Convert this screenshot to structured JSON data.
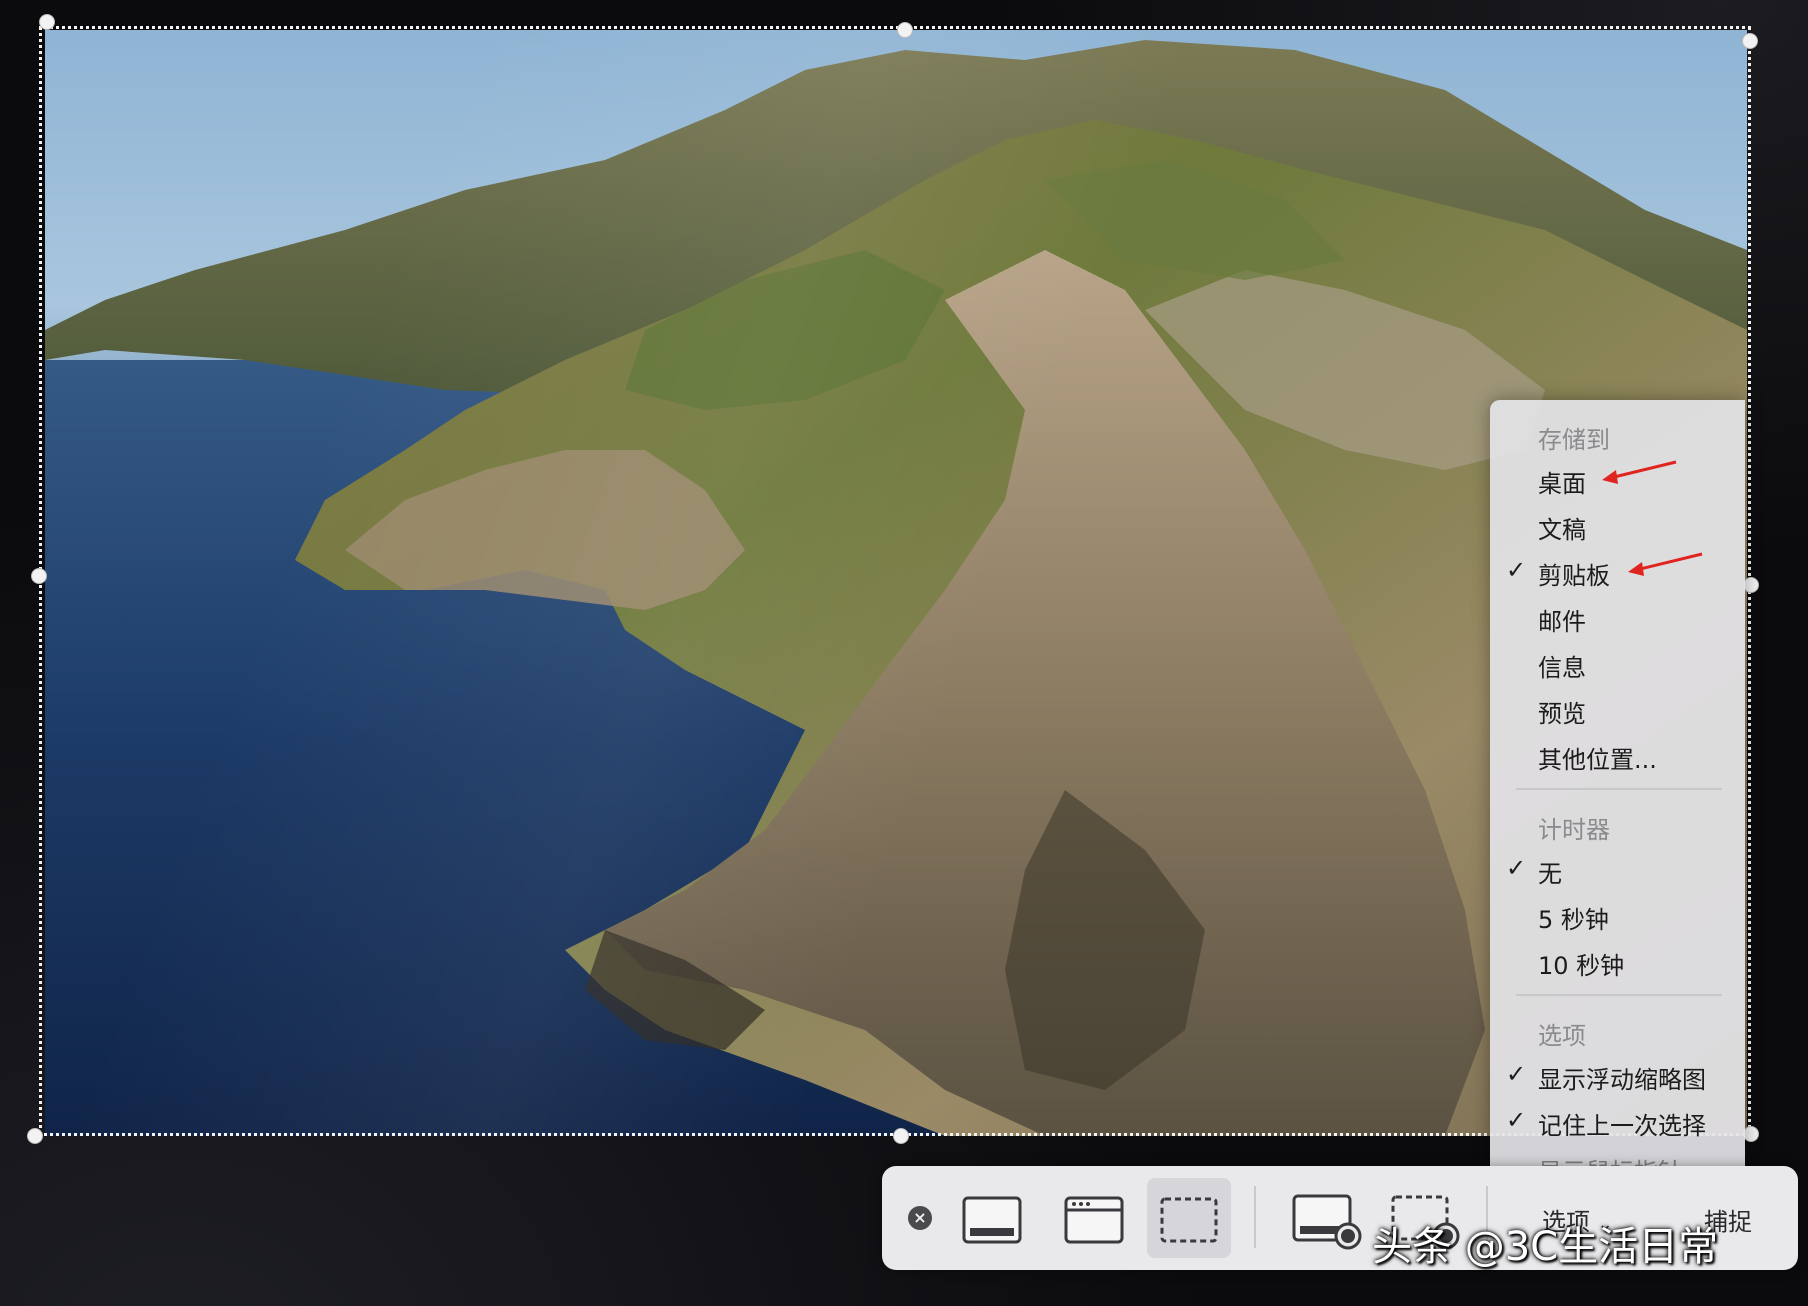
{
  "menu": {
    "save_to": {
      "header": "存储到",
      "items": [
        "桌面",
        "文稿",
        "剪贴板",
        "邮件",
        "信息",
        "预览",
        "其他位置..."
      ],
      "checked": "剪贴板"
    },
    "timer": {
      "header": "计时器",
      "items": [
        "无",
        "5 秒钟",
        "10 秒钟"
      ],
      "checked": "无"
    },
    "options": {
      "header": "选项",
      "items": [
        "显示浮动缩略图",
        "记住上一次选择"
      ],
      "partial_item": "显示鼠标指针"
    },
    "check_mark": "✓"
  },
  "toolbar": {
    "close_glyph": "×",
    "options_label": "选项",
    "options_caret": "⌄",
    "capture_label": "捕捉",
    "selected_tool": "capture-selected-portion"
  },
  "watermark": "头条 @3C生活日常",
  "colors": {
    "annotation_arrow": "#e0241f",
    "menu_bg": "#e4e4e8",
    "toolbar_bg": "#e9e9ec"
  }
}
